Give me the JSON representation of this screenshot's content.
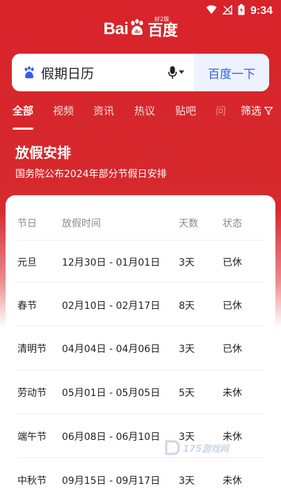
{
  "status_bar": {
    "time": "9:34"
  },
  "logo": {
    "latin": "Bai",
    "du": "du",
    "chinese": "百度",
    "badge": "好2版"
  },
  "search": {
    "query": "假期日历",
    "button_label": "百度一下"
  },
  "tabs": [
    {
      "label": "全部",
      "active": true
    },
    {
      "label": "视频",
      "active": false
    },
    {
      "label": "资讯",
      "active": false
    },
    {
      "label": "热议",
      "active": false
    },
    {
      "label": "贴吧",
      "active": false
    },
    {
      "label": "问",
      "active": false
    }
  ],
  "filter_label": "筛选",
  "card": {
    "title": "放假安排",
    "subtitle": "国务院公布2024年部分节假日安排"
  },
  "table": {
    "headers": [
      "节日",
      "放假时间",
      "天数",
      "状态"
    ],
    "rows": [
      [
        "元旦",
        "12月30日 - 01月01日",
        "3天",
        "已休"
      ],
      [
        "春节",
        "02月10日 - 02月17日",
        "8天",
        "已休"
      ],
      [
        "清明节",
        "04月04日 - 04月06日",
        "3天",
        "已休"
      ],
      [
        "劳动节",
        "05月01日 - 05月05日",
        "5天",
        "未休"
      ],
      [
        "端午节",
        "06月08日 - 06月10日",
        "3天",
        "未休"
      ],
      [
        "中秋节",
        "09月15日 - 09月17日",
        "3天",
        "未休"
      ]
    ]
  },
  "watermark": {
    "text": "175游戏网"
  },
  "colors": {
    "brand_red": "#d8232a",
    "button_blue": "#3060e6"
  }
}
